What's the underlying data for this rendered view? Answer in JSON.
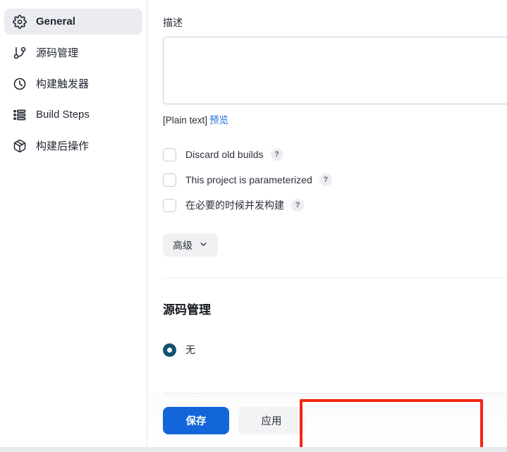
{
  "sidebar": {
    "items": [
      {
        "label": "General",
        "icon": "gear-icon",
        "active": true
      },
      {
        "label": "源码管理",
        "icon": "git-branch-icon",
        "active": false
      },
      {
        "label": "构建触发器",
        "icon": "clock-icon",
        "active": false
      },
      {
        "label": "Build Steps",
        "icon": "list-icon",
        "active": false
      },
      {
        "label": "构建后操作",
        "icon": "package-icon",
        "active": false
      }
    ]
  },
  "main": {
    "description": {
      "label": "描述",
      "value": "",
      "placeholder": "",
      "plain_text_label": "[Plain text]",
      "preview_link": "预览"
    },
    "checkboxes": [
      {
        "label": "Discard old builds",
        "checked": false,
        "help": "?"
      },
      {
        "label": "This project is parameterized",
        "checked": false,
        "help": "?"
      },
      {
        "label": "在必要的时候并发构建",
        "checked": false,
        "help": "?"
      }
    ],
    "advanced_button": {
      "label": "高级",
      "icon": "chevron-down-icon"
    },
    "scm": {
      "title": "源码管理",
      "options": [
        {
          "label": "无",
          "selected": true
        }
      ]
    }
  },
  "footer": {
    "save_label": "保存",
    "apply_label": "应用"
  },
  "colors": {
    "accent_blue": "#1266d9",
    "link_blue": "#1d6fe0",
    "radio_navy": "#15506e",
    "annotation_red": "#f22613",
    "sidebar_active_bg": "#ebecf0"
  }
}
